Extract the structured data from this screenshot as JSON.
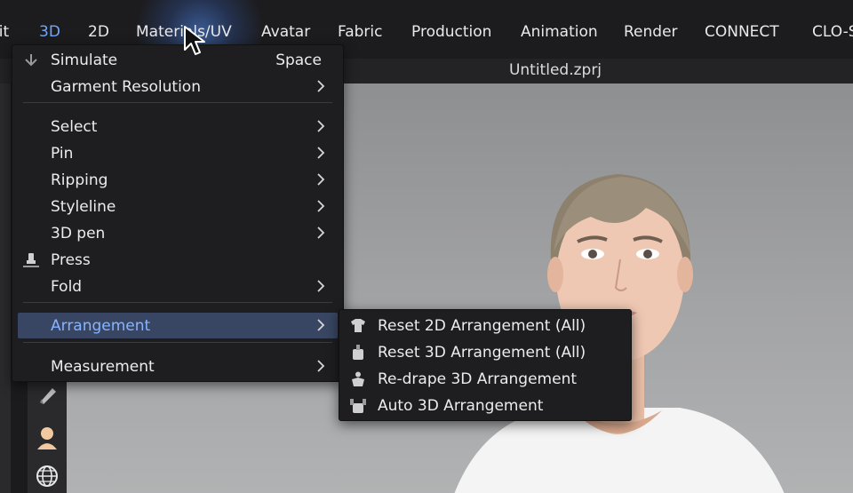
{
  "menubar": {
    "items": [
      "lit",
      "3D",
      "2D",
      "Materials/UV",
      "Avatar",
      "Fabric",
      "Production",
      "Animation",
      "Render",
      "CONNECT",
      "CLO-S"
    ],
    "active_index": 1
  },
  "window": {
    "title": "Untitled.zprj"
  },
  "menu_3d": {
    "items": [
      {
        "label": "Simulate",
        "shortcut": "Space",
        "icon": "simulate-icon"
      },
      {
        "label": "Garment Resolution",
        "has_submenu": true
      },
      {
        "label": "Select",
        "has_submenu": true
      },
      {
        "label": "Pin",
        "has_submenu": true
      },
      {
        "label": "Ripping",
        "has_submenu": true
      },
      {
        "label": "Styleline",
        "has_submenu": true
      },
      {
        "label": "3D pen",
        "has_submenu": true
      },
      {
        "label": "Press",
        "icon": "press-icon"
      },
      {
        "label": "Fold",
        "has_submenu": true
      },
      {
        "label": "Arrangement",
        "has_submenu": true,
        "highlighted": true
      },
      {
        "label": "Measurement",
        "has_submenu": true
      }
    ]
  },
  "arrangement_submenu": {
    "items": [
      {
        "label": "Reset 2D Arrangement (All)",
        "icon": "reset-2d-arrangement-icon"
      },
      {
        "label": "Reset 3D Arrangement (All)",
        "icon": "reset-3d-arrangement-icon"
      },
      {
        "label": "Re-drape 3D Arrangement",
        "icon": "redrape-3d-icon"
      },
      {
        "label": "Auto 3D Arrangement",
        "icon": "auto-3d-arrangement-icon"
      }
    ]
  },
  "toolbar": {
    "icons": [
      "fold-tool-icon",
      "avatar-tool-icon",
      "globe-icon"
    ]
  },
  "colors": {
    "accent": "#6ea8ff",
    "highlight_bg": "#394663",
    "menu_bg": "#1e1e21"
  }
}
